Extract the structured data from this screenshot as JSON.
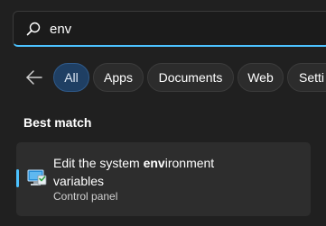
{
  "search": {
    "query": "env"
  },
  "filters": [
    {
      "label": "All",
      "active": true
    },
    {
      "label": "Apps",
      "active": false
    },
    {
      "label": "Documents",
      "active": false
    },
    {
      "label": "Web",
      "active": false
    },
    {
      "label": "Setti",
      "active": false
    }
  ],
  "best_match": {
    "heading": "Best match",
    "result": {
      "title_prefix": "Edit the system ",
      "title_match": "env",
      "title_suffix": "ironment",
      "title_line2": "variables",
      "subtitle": "Control panel",
      "icon": "system-properties-icon"
    }
  },
  "colors": {
    "background": "#202020",
    "accent": "#4cc2ff",
    "active_pill": "#1f3f63",
    "card": "#2d2d2d"
  }
}
